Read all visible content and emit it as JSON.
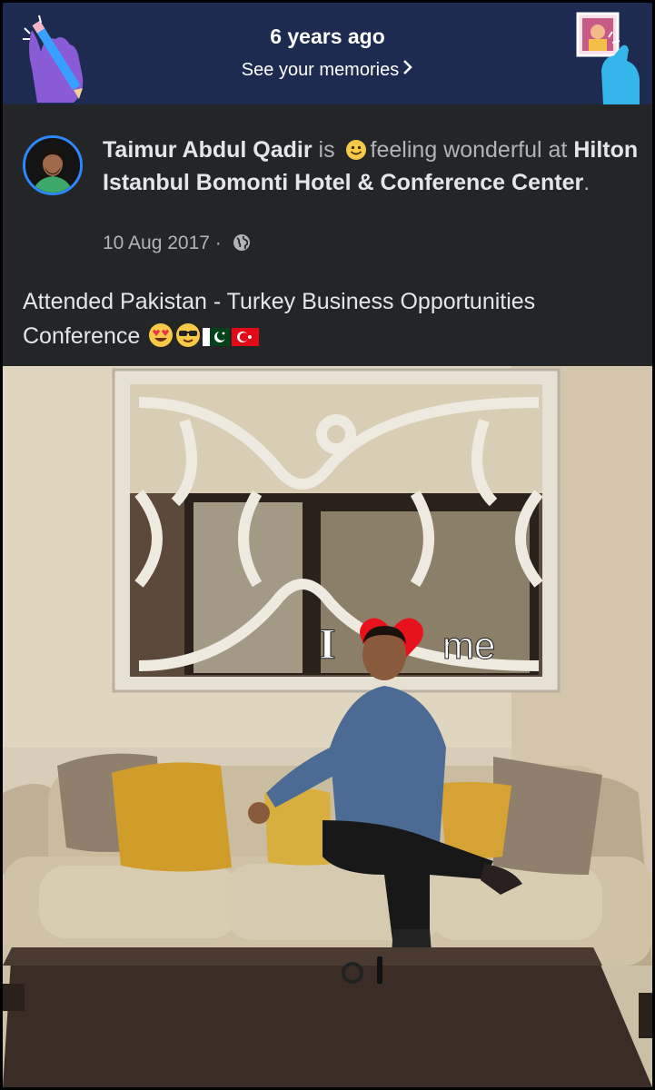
{
  "memories": {
    "time_ago": "6 years ago",
    "link_label": "See your memories"
  },
  "post": {
    "author": "Taimur Abdul Qadir",
    "connector_is": "is",
    "feeling": "feeling wonderful",
    "connector_at": "at",
    "place": "Hilton Istanbul Bomonti Hotel & Conference Center",
    "date": "10 Aug 2017",
    "separator": "·",
    "privacy_icon": "globe-icon",
    "caption": "Attended Pakistan - Turkey Business Opportunities Conference"
  },
  "photo": {
    "overlay_text_left": "I",
    "overlay_text_right": "me"
  },
  "colors": {
    "banner": "#1c2b4f",
    "card": "#242526",
    "accent": "#2d88ff",
    "text_primary": "#e4e6eb",
    "text_secondary": "#b0b3b8"
  }
}
